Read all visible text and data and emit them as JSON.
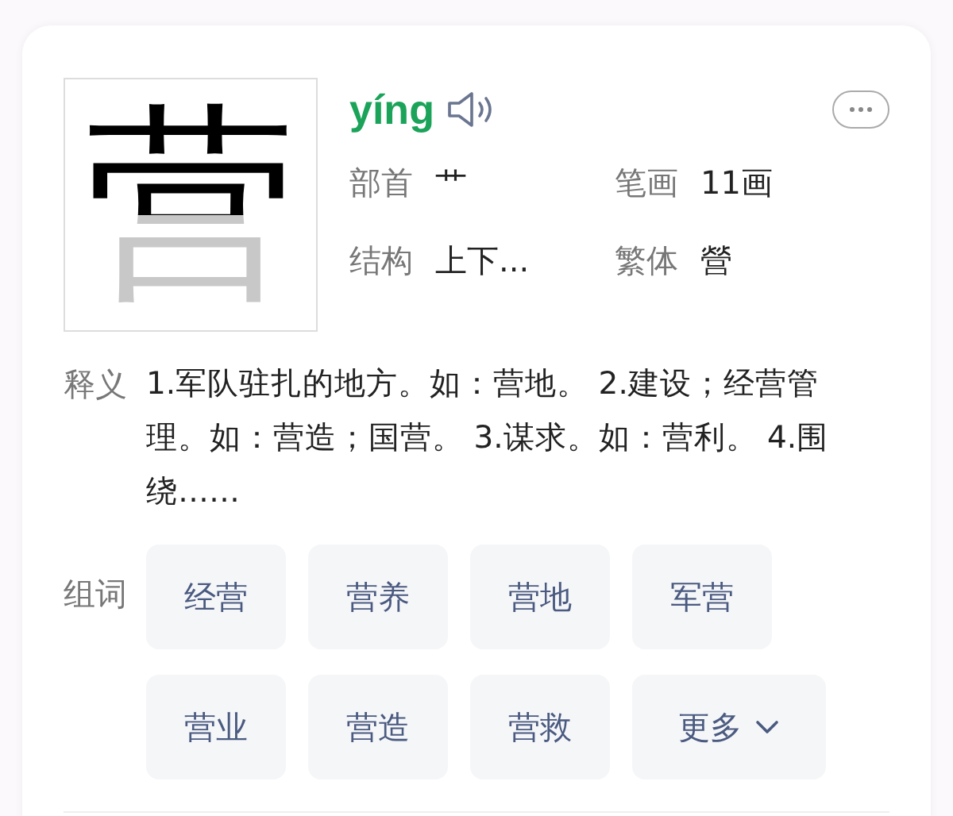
{
  "character": {
    "glyph": "营"
  },
  "pinyin": "yíng",
  "info": [
    {
      "label": "部首",
      "value": "艹"
    },
    {
      "label": "笔画",
      "value": "11画"
    },
    {
      "label": "结构",
      "value": "上下..."
    },
    {
      "label": "繁体",
      "value": "營"
    }
  ],
  "definition": {
    "label": "释义",
    "text": "1.军队驻扎的地方。如：营地。 2.建设；经营管理。如：营造；国营。 3.谋求。如：营利。 4.围绕……"
  },
  "words": {
    "label": "组词",
    "items": [
      {
        "text": "经营",
        "kind": "word"
      },
      {
        "text": "营养",
        "kind": "word"
      },
      {
        "text": "营地",
        "kind": "word"
      },
      {
        "text": "军营",
        "kind": "word"
      },
      {
        "text": "营业",
        "kind": "word"
      },
      {
        "text": "营造",
        "kind": "word"
      },
      {
        "text": "营救",
        "kind": "word"
      },
      {
        "text": "更多",
        "kind": "more"
      }
    ]
  }
}
